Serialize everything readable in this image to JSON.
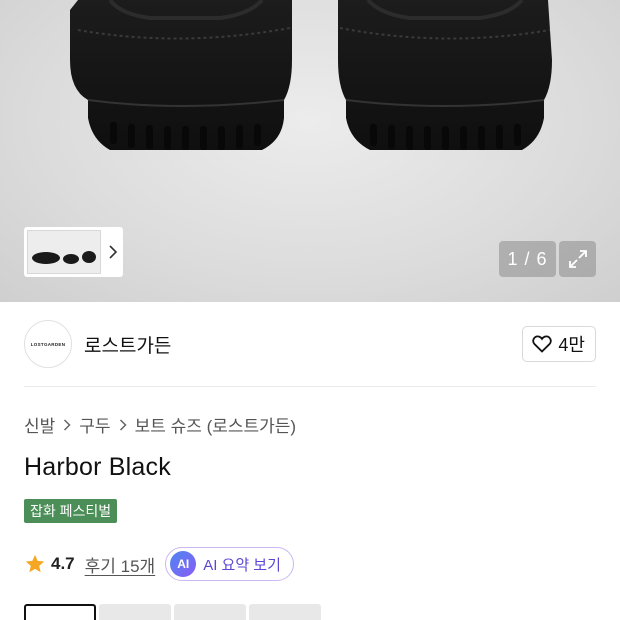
{
  "gallery": {
    "counter": "1 / 6",
    "thumb_icon": "chevron-right-icon",
    "expand_icon": "expand-icon"
  },
  "brand": {
    "logo_text": "LOSTGARDEN",
    "name": "로스트가든",
    "likes": "4만",
    "like_icon": "heart-outline-icon"
  },
  "breadcrumb": [
    "신발",
    "구두",
    "보트 슈즈 (로스트가든)"
  ],
  "product": {
    "title": "Harbor Black",
    "badge": "잡화 페스티벌",
    "badge_color": "#4c8e57"
  },
  "rating": {
    "score": "4.7",
    "reviews": "후기 15개",
    "star_color": "#f5a623",
    "ai_badge": "AI",
    "ai_label": "AI 요약 보기"
  },
  "options": {
    "count": 4,
    "selected_index": 0
  }
}
